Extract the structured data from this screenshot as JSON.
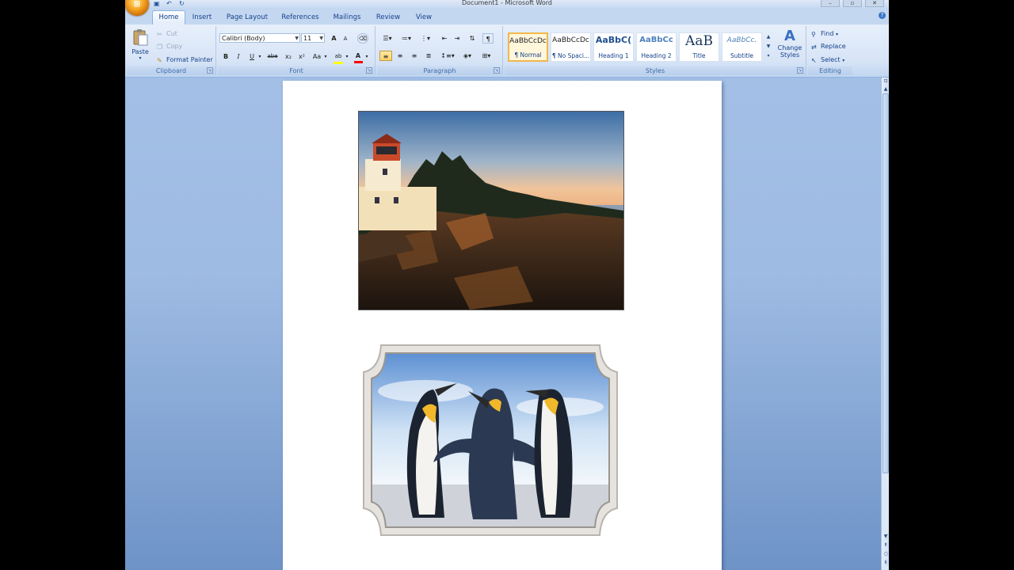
{
  "window": {
    "title": "Document1 - Microsoft Word",
    "controls": [
      "–",
      "▫",
      "✕"
    ]
  },
  "qat": {
    "save_icon": "save-icon",
    "undo_icon": "undo-icon",
    "redo_icon": "redo-icon"
  },
  "tabs": [
    {
      "label": "Home",
      "active": true
    },
    {
      "label": "Insert"
    },
    {
      "label": "Page Layout"
    },
    {
      "label": "References"
    },
    {
      "label": "Mailings"
    },
    {
      "label": "Review"
    },
    {
      "label": "View"
    }
  ],
  "clipboard": {
    "paste": "Paste",
    "cut": "Cut",
    "copy": "Copy",
    "format_painter": "Format Painter",
    "group": "Clipboard"
  },
  "font": {
    "name": "Calibri (Body)",
    "size": "11",
    "group": "Font",
    "bold": "B",
    "italic": "I",
    "underline": "U",
    "strike": "abe",
    "subscript": "x₂",
    "superscript": "x²",
    "change_case": "Aa",
    "grow": "A",
    "shrink": "A"
  },
  "paragraph": {
    "group": "Paragraph",
    "pilcrow": "¶"
  },
  "styles": {
    "group": "Styles",
    "items": [
      {
        "sample": "AaBbCcDc",
        "name": "¶ Normal",
        "selected": true
      },
      {
        "sample": "AaBbCcDc",
        "name": "¶ No Spaci..."
      },
      {
        "sample": "AaBbC(",
        "name": "Heading 1"
      },
      {
        "sample": "AaBbCc",
        "name": "Heading 2"
      },
      {
        "sample": "AaB",
        "name": "Title"
      },
      {
        "sample": "AaBbCc.",
        "name": "Subtitle"
      }
    ],
    "change_styles": "Change Styles"
  },
  "editing": {
    "group": "Editing",
    "find": "Find",
    "replace": "Replace",
    "select": "Select"
  },
  "colors": {
    "ribbon": "#dbe6f6",
    "accent": "#15428b",
    "highlight": "#ffff00",
    "font_color": "#ff0000"
  }
}
